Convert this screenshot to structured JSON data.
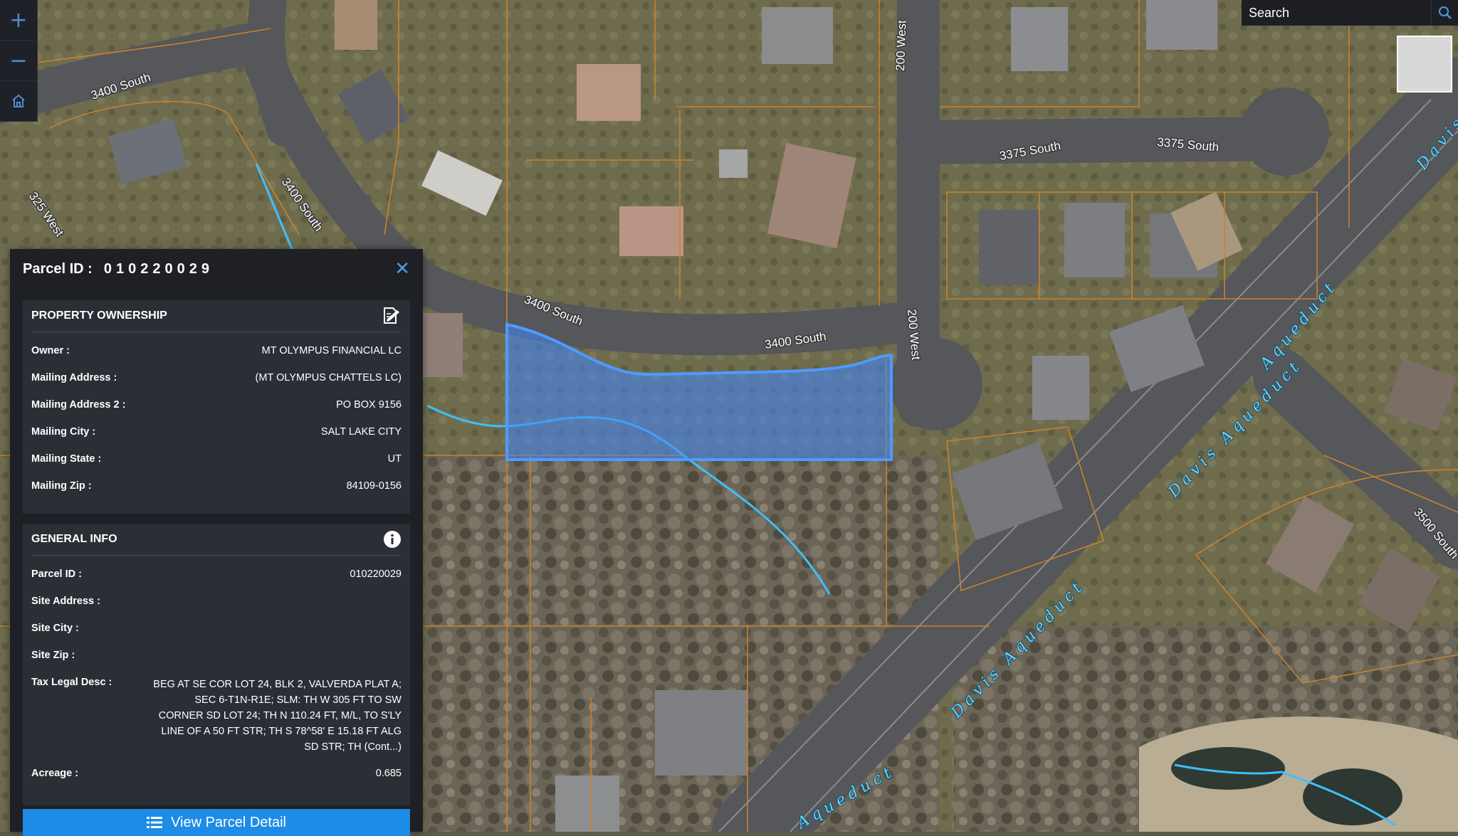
{
  "map": {
    "streets": [
      "3400 South",
      "3400 South",
      "3400 South",
      "325 West",
      "200 West",
      "200 West",
      "3375 South",
      "3375 South",
      "3500 South"
    ],
    "canal_labels": [
      "Davis Aqueduct",
      "Davis Aqueduct",
      "Aqueduct",
      "Aqueduct",
      "Davis"
    ],
    "parcel_highlight_color": "#3f86ff"
  },
  "controls": {
    "zoom_in": "+",
    "zoom_out": "−",
    "home_icon": "home-icon",
    "search_placeholder": "Search",
    "search_icon": "search-icon"
  },
  "popup": {
    "title_label": "Parcel ID :",
    "title_value": "010220029",
    "close_icon": "close-icon",
    "ownership": {
      "heading": "PROPERTY OWNERSHIP",
      "edit_icon": "edit-document-icon",
      "rows": [
        {
          "label": "Owner :",
          "value": "MT OLYMPUS FINANCIAL LC"
        },
        {
          "label": "Mailing Address :",
          "value": "(MT OLYMPUS CHATTELS LC)"
        },
        {
          "label": "Mailing Address 2 :",
          "value": "PO BOX 9156"
        },
        {
          "label": "Mailing City :",
          "value": "SALT LAKE CITY"
        },
        {
          "label": "Mailing State :",
          "value": "UT"
        },
        {
          "label": "Mailing Zip :",
          "value": "84109-0156"
        }
      ]
    },
    "general": {
      "heading": "GENERAL INFO",
      "info_icon": "info-icon",
      "rows": [
        {
          "label": "Parcel ID :",
          "value": "010220029"
        },
        {
          "label": "Site Address :",
          "value": ""
        },
        {
          "label": "Site City :",
          "value": ""
        },
        {
          "label": "Site Zip :",
          "value": ""
        },
        {
          "label": "Tax Legal Desc :",
          "value": "BEG AT SE COR LOT 24, BLK 2, VALVERDA PLAT A; SEC 6-T1N-R1E; SLM: TH W 305 FT TO SW CORNER SD LOT 24; TH N 110.24 FT, M/L, TO S'LY LINE OF A 50 FT STR; TH S 78^58' E 15.18 FT ALG SD STR; TH (Cont...)"
        },
        {
          "label": "Acreage :",
          "value": "0.685"
        }
      ]
    },
    "view_button": "View Parcel Detail",
    "view_button_icon": "list-icon"
  }
}
